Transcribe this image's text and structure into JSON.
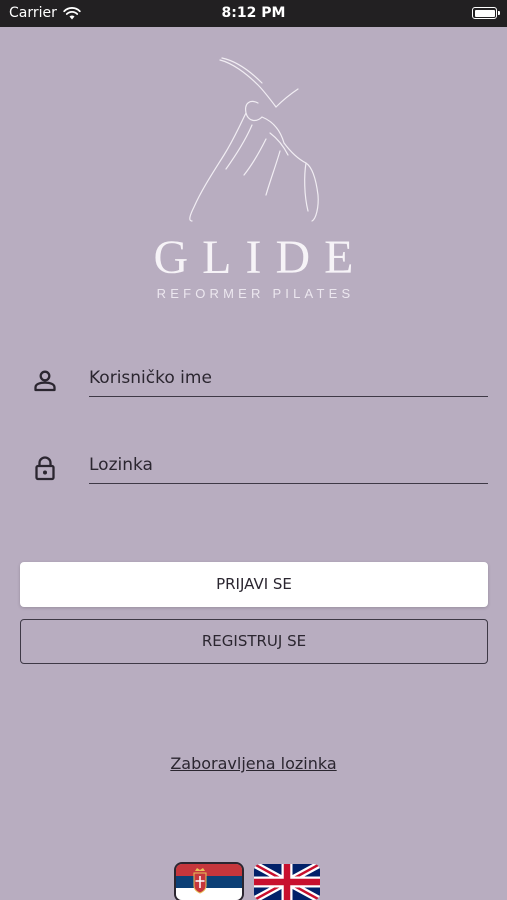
{
  "status_bar": {
    "carrier": "Carrier",
    "time": "8:12 PM"
  },
  "logo": {
    "title": "GLIDE",
    "subtitle": "REFORMER PILATES"
  },
  "form": {
    "username": {
      "placeholder": "Korisničko ime",
      "value": "",
      "icon": "person-icon"
    },
    "password": {
      "placeholder": "Lozinka",
      "value": "",
      "icon": "lock-icon"
    }
  },
  "buttons": {
    "login_label": "PRIJAVI SE",
    "register_label": "REGISTRUJ SE"
  },
  "forgot_password_label": "Zaboravljena lozinka",
  "languages": [
    {
      "code": "sr",
      "icon": "serbia-flag-icon",
      "selected": true
    },
    {
      "code": "en",
      "icon": "uk-flag-icon",
      "selected": false
    }
  ],
  "colors": {
    "background": "#b8adc0",
    "text": "#2b2630",
    "button_primary": "#ffffff"
  }
}
